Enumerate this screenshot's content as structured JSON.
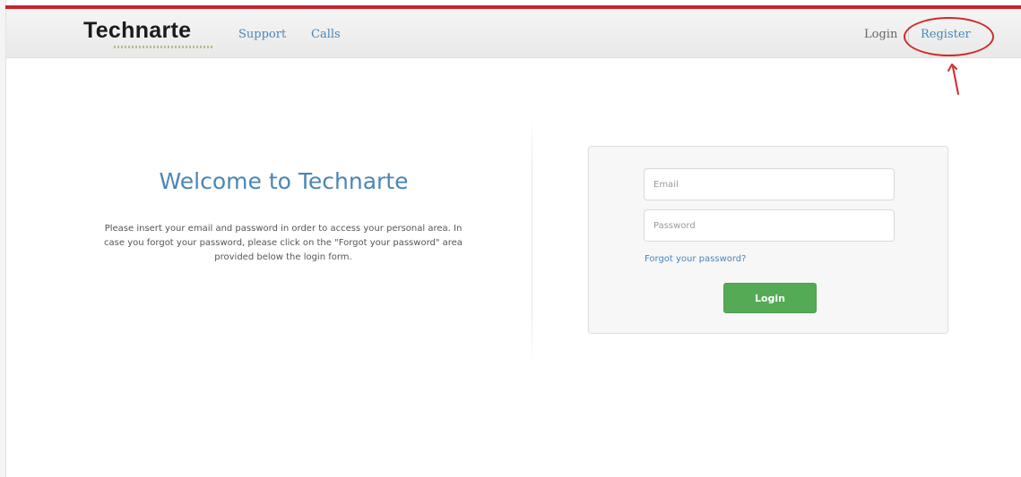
{
  "header": {
    "brand": "Technarte",
    "nav": {
      "support": "Support",
      "calls": "Calls",
      "login": "Login",
      "register": "Register"
    }
  },
  "main": {
    "welcome": {
      "title": "Welcome to Technarte",
      "text": "Please insert your email and password in order to access your personal area. In case you forgot your password, please click on the \"Forgot your password\" area provided below the login form."
    },
    "login_form": {
      "email_placeholder": "Email",
      "password_placeholder": "Password",
      "forgot_link": "Forgot your password?",
      "login_button": "Login"
    }
  },
  "colors": {
    "accent_red": "#c8232b",
    "link_blue": "#4a86b8",
    "button_green": "#55ab55"
  }
}
